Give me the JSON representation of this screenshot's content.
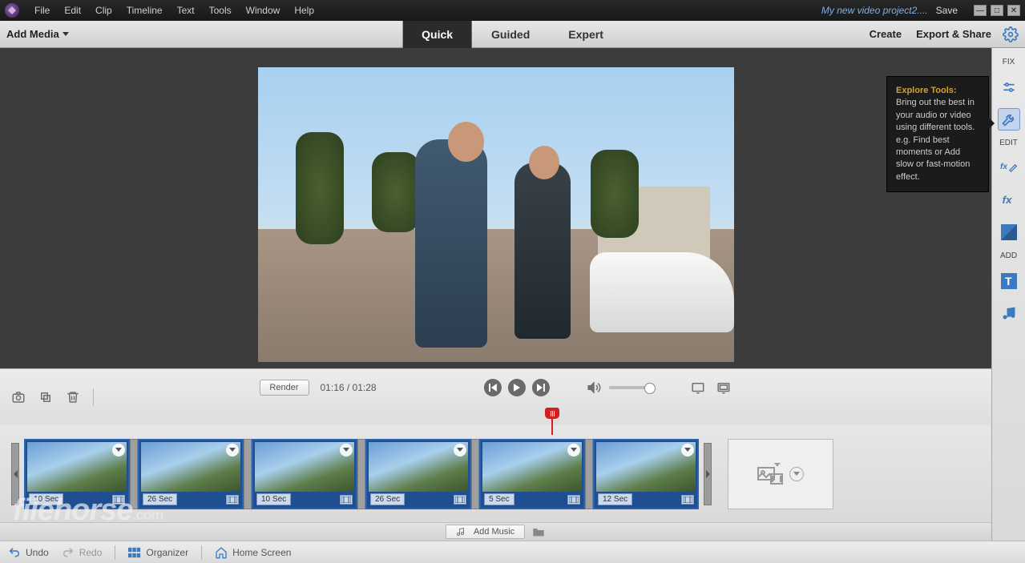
{
  "menubar": [
    "File",
    "Edit",
    "Clip",
    "Timeline",
    "Text",
    "Tools",
    "Window",
    "Help"
  ],
  "project_name": "My new video project2....",
  "save_label": "Save",
  "modebar": {
    "add_media": "Add Media",
    "tabs": [
      "Quick",
      "Guided",
      "Expert"
    ],
    "active_tab": "Quick",
    "create": "Create",
    "export": "Export & Share"
  },
  "tooltip": {
    "title": "Explore Tools:",
    "body": "Bring out the best in your audio or video using different tools. e.g. Find best moments or Add slow or fast-motion effect."
  },
  "right_rail": {
    "section1": "FIX",
    "section2": "EDIT",
    "section3": "ADD"
  },
  "controls": {
    "render": "Render",
    "timecode": "01:16 / 01:28"
  },
  "clips": [
    {
      "duration": "10 Sec"
    },
    {
      "duration": "26 Sec"
    },
    {
      "duration": "10 Sec"
    },
    {
      "duration": "26 Sec"
    },
    {
      "duration": "5 Sec"
    },
    {
      "duration": "12 Sec"
    }
  ],
  "add_music": "Add Music",
  "bottombar": {
    "undo": "Undo",
    "redo": "Redo",
    "organizer": "Organizer",
    "home": "Home Screen"
  },
  "watermark": {
    "main": "filehorse",
    "suffix": ".com"
  }
}
